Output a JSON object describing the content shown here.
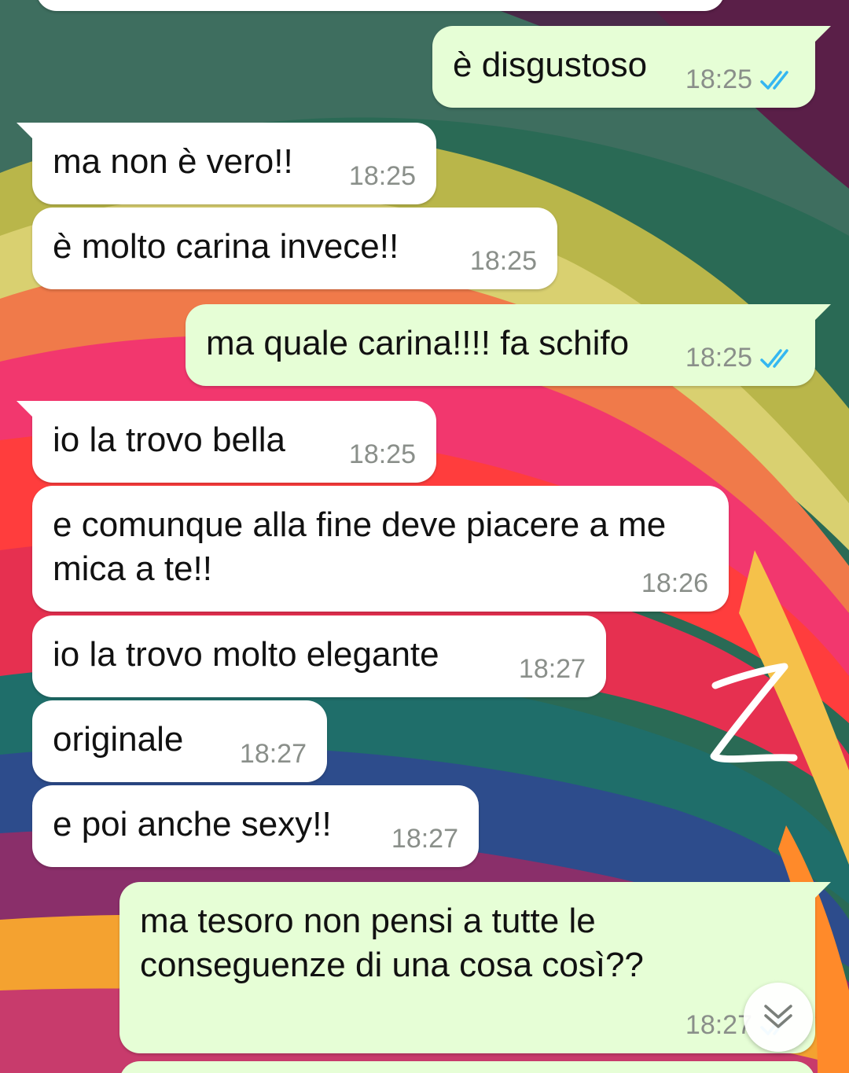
{
  "messages": [
    {
      "id": "m0",
      "direction": "in",
      "text": "",
      "time": ""
    },
    {
      "id": "m1",
      "direction": "out",
      "text": "è disgustoso",
      "time": "18:25",
      "status": "read"
    },
    {
      "id": "m2",
      "direction": "in",
      "text": "ma non è vero!!",
      "time": "18:25"
    },
    {
      "id": "m3",
      "direction": "in",
      "text": "è molto carina invece!!",
      "time": "18:25"
    },
    {
      "id": "m4",
      "direction": "out",
      "text": "ma quale carina!!!! fa schifo",
      "time": "18:25",
      "status": "read"
    },
    {
      "id": "m5",
      "direction": "in",
      "text": "io la trovo bella",
      "time": "18:25"
    },
    {
      "id": "m6",
      "direction": "in",
      "text": "e comunque alla fine deve piacere a me mica a te!!",
      "time": "18:26"
    },
    {
      "id": "m7",
      "direction": "in",
      "text": "io la trovo molto elegante",
      "time": "18:27"
    },
    {
      "id": "m8",
      "direction": "in",
      "text": "originale",
      "time": "18:27"
    },
    {
      "id": "m9",
      "direction": "in",
      "text": "e poi anche sexy!!",
      "time": "18:27"
    },
    {
      "id": "m10",
      "direction": "out",
      "text": "ma tesoro non pensi a tutte le conseguenze di una cosa così??",
      "time": "18:27",
      "status": "read"
    }
  ],
  "colors": {
    "incoming_bubble": "#ffffff",
    "outgoing_bubble": "#e6fed6",
    "read_ticks": "#34b7f1",
    "timestamp": "#8a8f8a"
  },
  "icons": {
    "read_status": "double-check-icon",
    "scroll_down": "chevron-double-down-icon",
    "watermark": "handwritten-z-watermark"
  }
}
